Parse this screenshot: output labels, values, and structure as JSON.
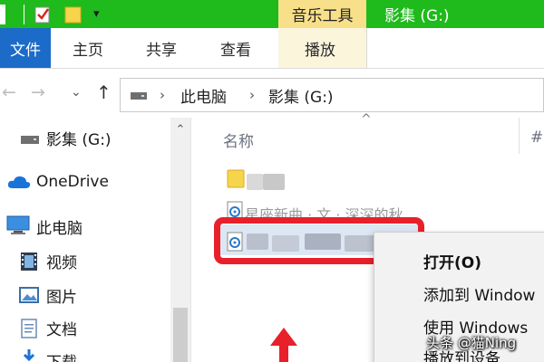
{
  "titlebar": {
    "tool_group_label": "音乐工具",
    "window_title": "影集 (G:)",
    "qat_dropdown_glyph": "▾",
    "accent_color": "#1fba1c"
  },
  "ribbon": {
    "tabs": [
      {
        "label": "文件",
        "active": true
      },
      {
        "label": "主页"
      },
      {
        "label": "共享"
      },
      {
        "label": "查看"
      },
      {
        "label": "播放"
      }
    ]
  },
  "address": {
    "back_glyph": "←",
    "forward_glyph": "→",
    "dropdown_glyph": "⌄",
    "up_glyph": "↑",
    "separator_glyph": "›",
    "crumbs": [
      "此电脑",
      "影集 (G:)"
    ]
  },
  "nav": {
    "items": [
      {
        "label": "影集 (G:)",
        "icon": "drive-icon"
      },
      {
        "label": "OneDrive",
        "icon": "cloud-icon"
      },
      {
        "label": "此电脑",
        "icon": "computer-icon"
      },
      {
        "label": "视频",
        "icon": "video-icon"
      },
      {
        "label": "图片",
        "icon": "picture-icon"
      },
      {
        "label": "文档",
        "icon": "document-icon"
      },
      {
        "label": "下载",
        "icon": "download-icon"
      }
    ],
    "scroll_up_glyph": "⌃"
  },
  "content": {
    "column_name": "名称",
    "column_next": "#",
    "sort_caret": "^",
    "rows": [
      {
        "type": "folder",
        "visible_text": ""
      },
      {
        "type": "audio",
        "visible_text": "星座新曲 · 文 · 深深的秋..."
      },
      {
        "type": "audio",
        "visible_text": "",
        "selected": true
      }
    ]
  },
  "context_menu": {
    "items": [
      {
        "label": "打开(O)",
        "bold": true
      },
      {
        "label": "添加到 Window"
      },
      {
        "label": "使用 Windows"
      },
      {
        "label": "播放到设备"
      }
    ]
  },
  "watermark": "头条 @猫Ning"
}
